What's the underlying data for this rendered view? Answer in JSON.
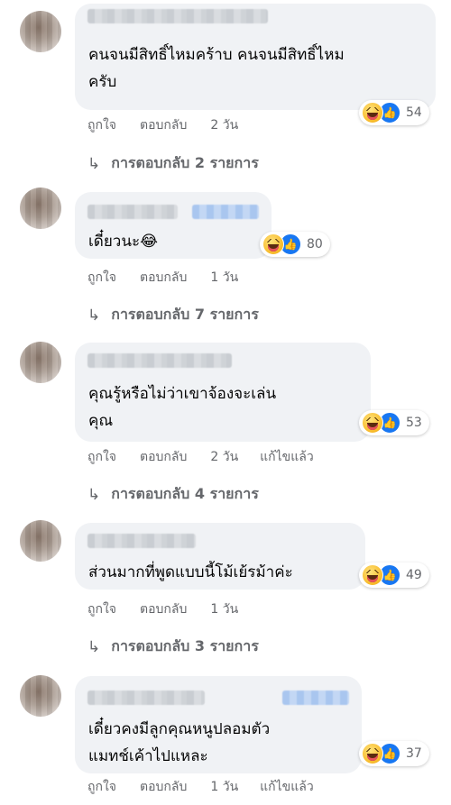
{
  "comments": [
    {
      "text": "คนจนมีสิทธิ์ไหมคร้าบ คนจนมีสิทธิ์ไหม\nครับ",
      "reaction_count": "54",
      "like": "ถูกใจ",
      "reply": "ตอบกลับ",
      "time": "2 วัน",
      "edited": "",
      "replies": "การตอบกลับ 2 รายการ"
    },
    {
      "text": "เดี๋ยวนะ😂",
      "reaction_count": "80",
      "like": "ถูกใจ",
      "reply": "ตอบกลับ",
      "time": "1 วัน",
      "edited": "",
      "replies": "การตอบกลับ 7 รายการ"
    },
    {
      "text": "คุณรู้หรือไม่ว่าเขาจ้องจะเล่น\nคุณ",
      "reaction_count": "53",
      "like": "ถูกใจ",
      "reply": "ตอบกลับ",
      "time": "2 วัน",
      "edited": "แก้ไขแล้ว",
      "replies": "การตอบกลับ 4 รายการ"
    },
    {
      "text": "ส่วนมากที่พูดแบบนี้โม้เย้รม้าค่ะ",
      "reaction_count": "49",
      "like": "ถูกใจ",
      "reply": "ตอบกลับ",
      "time": "1 วัน",
      "edited": "",
      "replies": "การตอบกลับ 3 รายการ"
    },
    {
      "text": "เดี๋ยวคงมีลูกคุณหนูปลอมตัว\nแมทช์เค้าไปแหละ",
      "reaction_count": "37",
      "like": "ถูกใจ",
      "reply": "ตอบกลับ",
      "time": "1 วัน",
      "edited": "แก้ไขแล้ว",
      "replies": ""
    }
  ],
  "icons": {
    "reaction_1": "haha-icon",
    "reaction_2": "like-icon",
    "reply_arrow": "reply-arrow-icon"
  },
  "colors": {
    "bubble": "#f0f2f5",
    "secondary_text": "#65676b",
    "like_blue": "#1877f2",
    "haha_yellow": "#f7b928"
  }
}
